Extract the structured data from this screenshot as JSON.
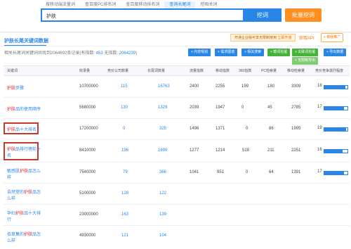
{
  "tabs": [
    "搜移动端流量词",
    "查百度PC排名词",
    "查百度移动排名词",
    "查询长尾词",
    "挖相关词"
  ],
  "active_tab": 3,
  "search": {
    "value": "护肤",
    "button": "挖词",
    "batch_button": "批量挖词"
  },
  "panel": {
    "title": "护肤长尾关键词数据",
    "promo_prefix": "开通企业版可享无限制使用",
    "promo_action": "立即开通",
    "api_link": "获取API",
    "ad_button": "+ 做我推广"
  },
  "summary": {
    "prefix": "相关长尾词关键词共找到",
    "total": "2064692",
    "middle": "条记录(有指数:",
    "indexed": "453",
    "middle2": "  无指数:",
    "no_index": "2064239",
    "suffix": ")"
  },
  "toolbar": [
    "+ 内容规划",
    "+ 需求图谱",
    "+ 相关搜索",
    "+ 截词挖掘",
    "+ 关联词挖掘",
    "+ 无限制导出",
    "+ 导出数据"
  ],
  "columns": [
    "关键词",
    "收录量",
    "竞价公司数量",
    "长尾词数量",
    "流量指数",
    "移动指数",
    "360指数",
    "PC检索量",
    "移动检索量",
    "竞价竞争激烈程度"
  ],
  "rows": [
    {
      "kw_pre": "",
      "kw_red": "护肤",
      "kw_post": "步骤",
      "kw_line2": "",
      "index": "10700000",
      "company": "115",
      "longtail": "16763",
      "flow": "2400",
      "mobile": "2255",
      "s360": "199",
      "pc": "180",
      "mobile_search": "3309",
      "compete": 18
    },
    {
      "kw_pre": "",
      "kw_red": "护肤",
      "kw_post": "品的使用顺序",
      "kw_line2": "",
      "index": "5680000",
      "company": "130",
      "longtail": "1329",
      "flow": "2039",
      "mobile": "1947",
      "s360": "0",
      "pc": "45",
      "mobile_search": "2785",
      "compete": 17
    },
    {
      "kw_pre": "",
      "kw_red": "护肤",
      "kw_post": "品十大排名",
      "kw_line2": "",
      "index": "17200000",
      "company": "0",
      "longtail": "325",
      "flow": "1496",
      "mobile": "1371",
      "s360": "0",
      "pc": "86",
      "mobile_search": "1995",
      "compete": 19
    },
    {
      "kw_pre": "",
      "kw_red": "护肤",
      "kw_post": "品排行榜前十",
      "kw_line2": "名",
      "index": "8410000",
      "company": "196",
      "longtail": "1699",
      "flow": "1277",
      "mobile": "1214",
      "s360": "518",
      "pc": "211",
      "mobile_search": "2251",
      "compete": 16
    },
    {
      "kw_pre": "敏感肌",
      "kw_red": "护肤",
      "kw_post": "品怎么",
      "kw_line2": "样",
      "index": "7540000",
      "company": "79",
      "longtail": "366",
      "flow": "1041",
      "mobile": "951",
      "s360": "0",
      "pc": "64",
      "mobile_search": "1391",
      "compete": 17
    },
    {
      "kw_pre": "自然堂的",
      "kw_red": "护肤",
      "kw_post": "品怎",
      "kw_line2": "么样",
      "index": "5100000",
      "company": "128",
      "longtail": "122",
      "flow": "",
      "mobile": "",
      "s360": "",
      "pc": "",
      "mobile_search": "",
      "compete": null
    },
    {
      "kw_pre": "孕妇",
      "kw_red": "护肤",
      "kw_post": "品十大排",
      "kw_line2": "行",
      "index": "23000000",
      "company": "163",
      "longtail": "139",
      "flow": "",
      "mobile": "",
      "s360": "",
      "pc": "",
      "mobile_search": "",
      "compete": null
    },
    {
      "kw_pre": "佰草集的",
      "kw_red": "护肤",
      "kw_post": "品怎",
      "kw_line2": "么样",
      "index": "4930000",
      "company": "121",
      "longtail": "104",
      "flow": "",
      "mobile": "",
      "s360": "",
      "pc": "",
      "mobile_search": "",
      "compete": null
    }
  ],
  "colors": {
    "accent": "#2a86e6",
    "orange": "#ff8f1f",
    "highlight_box": "#c53a2c",
    "keyword_red": "#e0262a"
  }
}
